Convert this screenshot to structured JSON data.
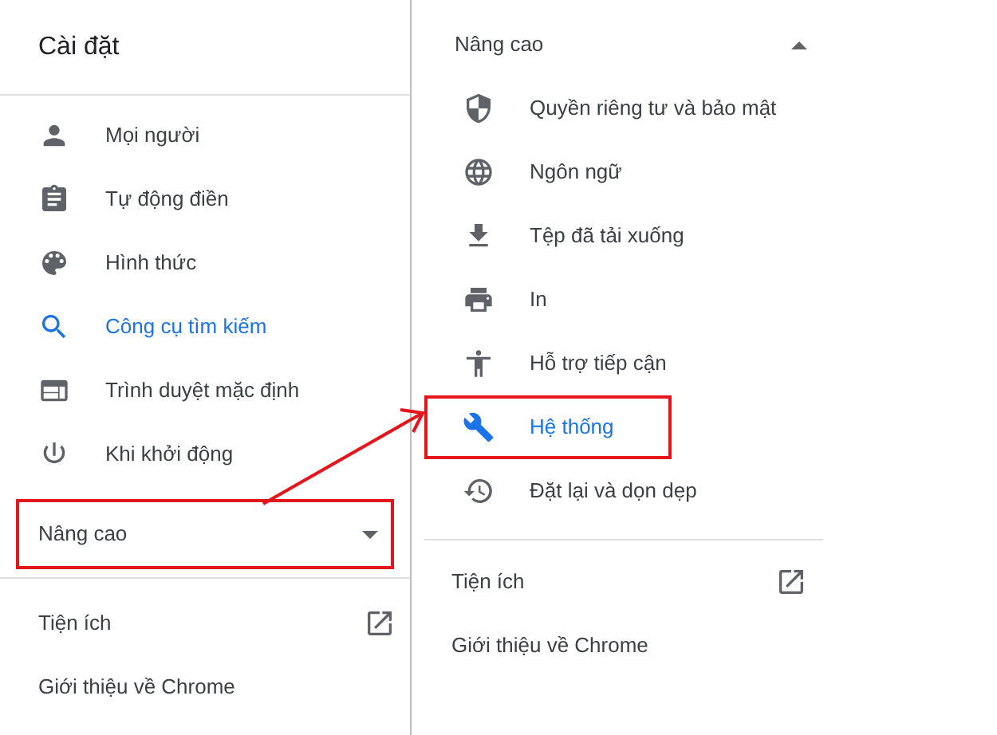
{
  "left_panel": {
    "title": "Cài đặt",
    "items": [
      {
        "label": "Mọi người",
        "selected": false
      },
      {
        "label": "Tự động điền",
        "selected": false
      },
      {
        "label": "Hình thức",
        "selected": false
      },
      {
        "label": "Công cụ tìm kiếm",
        "selected": true
      },
      {
        "label": "Trình duyệt mặc định",
        "selected": false
      },
      {
        "label": "Khi khởi động",
        "selected": false
      }
    ],
    "advanced": {
      "label": "Nâng cao",
      "expanded": false,
      "highlighted": true
    },
    "footer": [
      {
        "label": "Tiện ích",
        "external": true
      },
      {
        "label": "Giới thiệu về Chrome",
        "external": false
      }
    ]
  },
  "right_panel": {
    "advanced": {
      "label": "Nâng cao",
      "expanded": true
    },
    "items": [
      {
        "label": "Quyền riêng tư và bảo mật",
        "selected": false,
        "highlighted": false
      },
      {
        "label": "Ngôn ngữ",
        "selected": false,
        "highlighted": false
      },
      {
        "label": "Tệp đã tải xuống",
        "selected": false,
        "highlighted": false
      },
      {
        "label": "In",
        "selected": false,
        "highlighted": false
      },
      {
        "label": "Hỗ trợ tiếp cận",
        "selected": false,
        "highlighted": false
      },
      {
        "label": "Hệ thống",
        "selected": true,
        "highlighted": true
      },
      {
        "label": "Đặt lại và dọn dẹp",
        "selected": false,
        "highlighted": false
      }
    ],
    "footer": [
      {
        "label": "Tiện ích",
        "external": true
      },
      {
        "label": "Giới thiệu về Chrome",
        "external": false
      }
    ]
  }
}
